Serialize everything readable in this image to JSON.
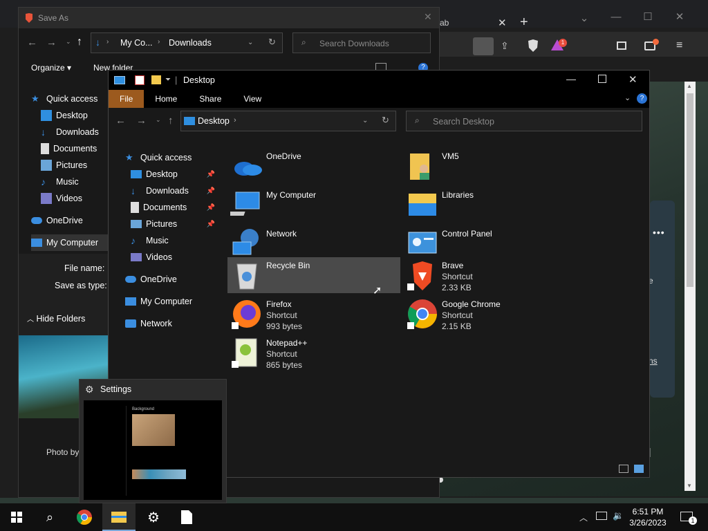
{
  "saveas": {
    "title": "Save As",
    "breadcrumb": [
      "My Co...",
      "Downloads"
    ],
    "search_placeholder": "Search Downloads",
    "organize_label": "Organize",
    "new_folder_label": "New folder",
    "nav": [
      "Quick access",
      "Desktop",
      "Downloads",
      "Documents",
      "Pictures",
      "Music",
      "Videos",
      "OneDrive",
      "My Computer"
    ],
    "file_name_label": "File name:",
    "save_as_type_label": "Save as type:",
    "hide_folders_label": "Hide Folders"
  },
  "browser": {
    "tab_partial": "ab",
    "badge_count": "1",
    "side_text_fragments": [
      "e",
      "ns"
    ],
    "photo_text": "Photo by"
  },
  "explorer": {
    "title": "Desktop",
    "ribbon_tabs": [
      "File",
      "Home",
      "Share",
      "View"
    ],
    "address_path": "Desktop",
    "search_placeholder": "Search Desktop",
    "nav": {
      "quick_access": "Quick access",
      "desktop": "Desktop",
      "downloads": "Downloads",
      "documents": "Documents",
      "pictures": "Pictures",
      "music": "Music",
      "videos": "Videos",
      "onedrive": "OneDrive",
      "my_computer": "My Computer",
      "network": "Network"
    },
    "items": [
      {
        "name": "OneDrive",
        "line2": "",
        "line3": "",
        "icon": "onedrive-icon"
      },
      {
        "name": "VM5",
        "line2": "",
        "line3": "",
        "icon": "user-folder-icon"
      },
      {
        "name": "My Computer",
        "line2": "",
        "line3": "",
        "icon": "computer-icon"
      },
      {
        "name": "Libraries",
        "line2": "",
        "line3": "",
        "icon": "libraries-icon"
      },
      {
        "name": "Network",
        "line2": "",
        "line3": "",
        "icon": "network-icon"
      },
      {
        "name": "Control Panel",
        "line2": "",
        "line3": "",
        "icon": "control-panel-icon"
      },
      {
        "name": "Recycle Bin",
        "line2": "",
        "line3": "",
        "icon": "recycle-bin-icon"
      },
      {
        "name": "Brave",
        "line2": "Shortcut",
        "line3": "2.33 KB",
        "icon": "brave-icon"
      },
      {
        "name": "Firefox",
        "line2": "Shortcut",
        "line3": "993 bytes",
        "icon": "firefox-icon"
      },
      {
        "name": "Google Chrome",
        "line2": "Shortcut",
        "line3": "2.15 KB",
        "icon": "chrome-icon"
      },
      {
        "name": "Notepad++",
        "line2": "Shortcut",
        "line3": "865 bytes",
        "icon": "notepadpp-icon"
      }
    ]
  },
  "settings_thumb": {
    "title": "Settings",
    "preview_heading": "Background"
  },
  "taskbar": {
    "time": "6:51 PM",
    "date": "3/26/2023",
    "notification_count": "1"
  },
  "colors": {
    "file_tab": "#9c5a1e",
    "accent_blue": "#1f8ad3",
    "selection": "#4a4a4a"
  }
}
